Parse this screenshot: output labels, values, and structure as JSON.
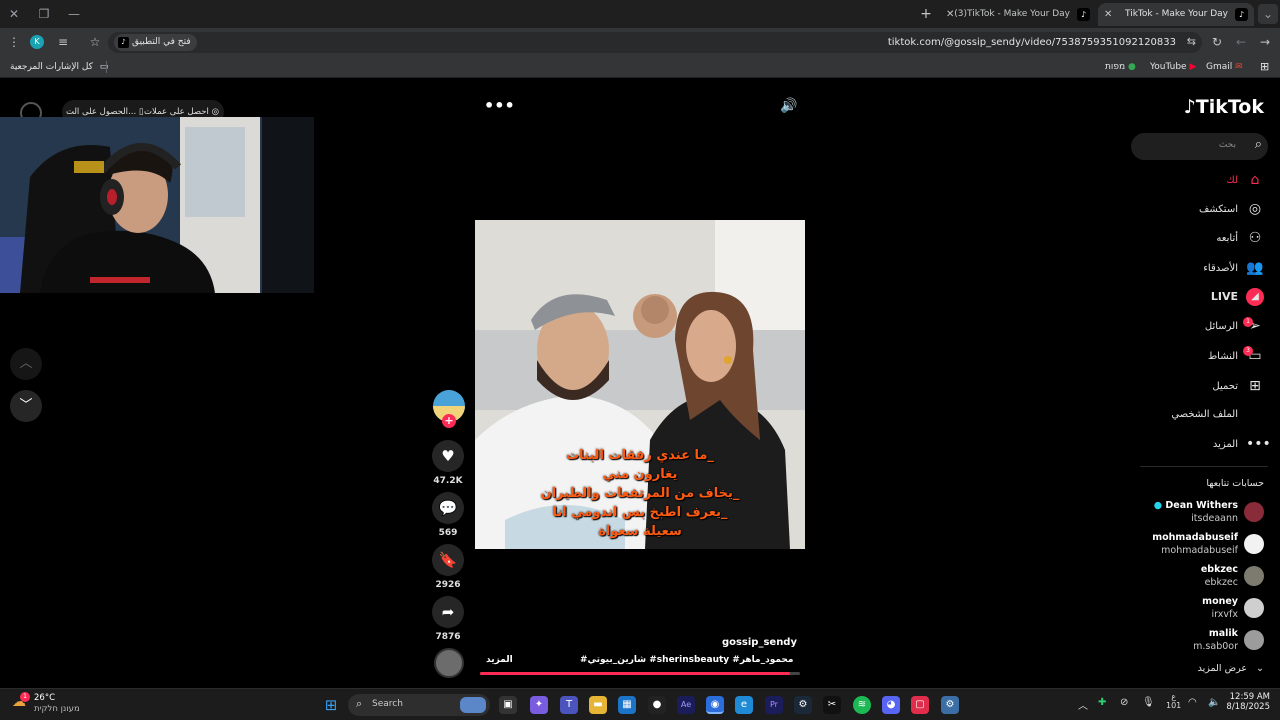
{
  "browser": {
    "tabs": [
      {
        "title": "(3)TikTok - Make Your Day",
        "active": false
      },
      {
        "title": "TikTok - Make Your Day",
        "active": true
      }
    ],
    "url": "tiktok.com/@gossip_sendy/video/7538759351092120833",
    "open_in_app": "فتح في التطبيق",
    "profile_initial": "K",
    "bookmarks": {
      "all_label": "كل الإشارات المرجعية",
      "items": [
        "Gmail",
        "YouTube",
        "מפות"
      ]
    }
  },
  "tiktok": {
    "logo": "TikTok",
    "search_placeholder": "بحث",
    "top_left": {
      "coins": "احصل على عملات",
      "get_app": "الحصول على الت..."
    },
    "nav": [
      {
        "label": "لك",
        "icon": "home-icon",
        "active": true
      },
      {
        "label": "استكشف",
        "icon": "compass-icon"
      },
      {
        "label": "أتابعه",
        "icon": "following-icon"
      },
      {
        "label": "الأصدقاء",
        "icon": "friends-icon"
      },
      {
        "label": "LIVE",
        "icon": "live-icon"
      },
      {
        "label": "الرسائل",
        "icon": "messages-icon",
        "badge": "1"
      },
      {
        "label": "النشاط",
        "icon": "activity-icon",
        "badge": "3"
      },
      {
        "label": "تحميل",
        "icon": "upload-icon"
      },
      {
        "label": "الملف الشخصي",
        "icon": "profile-icon"
      },
      {
        "label": "المزيد",
        "icon": "more-icon"
      }
    ],
    "following_header": "حسابات تتابعها",
    "following": [
      {
        "name": "Dean Withers",
        "handle": "itsdeaann",
        "verified": true,
        "color": "#8a2b3a"
      },
      {
        "name": "mohmadabuseif",
        "handle": "mohmadabuseif",
        "color": "#f2f2f2"
      },
      {
        "name": "ebkzec",
        "handle": "ebkzec",
        "color": "#7d7a70"
      },
      {
        "name": "money",
        "handle": "irxvfx",
        "color": "#cfcfcf"
      },
      {
        "name": "malik",
        "handle": "m.sab0or",
        "color": "#9c9c9c"
      }
    ],
    "show_more": "عرض المزيد",
    "video": {
      "captions": [
        "_ما عندي رفقات البنات",
        "يغارون مني",
        "_يخاف من المرتفعات والطيران",
        "_يعرف اطبخ بس اندومي انا",
        "سعيلة سعواة"
      ],
      "author": "gossip_sendy",
      "hashtags": "#شارين_بيوتي #sherinsbeauty #محمود_ماهر ...",
      "more": "المزيد",
      "progress": 0.97
    },
    "actions": [
      {
        "icon": "heart-icon",
        "count": "47.2K"
      },
      {
        "icon": "comment-icon",
        "count": "569"
      },
      {
        "icon": "bookmark-icon",
        "count": "2926"
      },
      {
        "icon": "share-icon",
        "count": "7876"
      }
    ]
  },
  "taskbar": {
    "weather_temp": "26°C",
    "weather_desc": "מעונן חלקית",
    "weather_badge": "1",
    "search_label": "Search",
    "time": "12:59 AM",
    "date": "8/18/2025",
    "lang": "ع",
    "lang_code": "101"
  }
}
